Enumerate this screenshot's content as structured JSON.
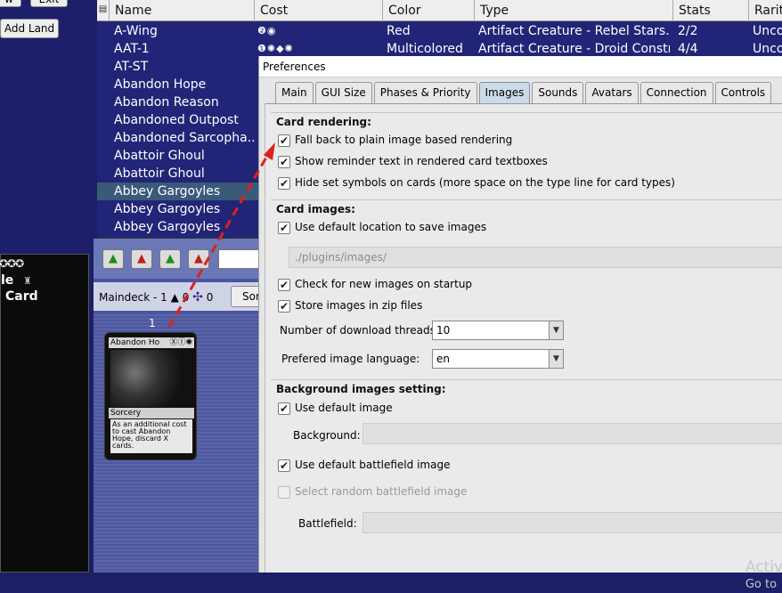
{
  "top_buttons": {
    "first": "w",
    "exit": "Exit",
    "add_land": "Add Land"
  },
  "sidebar_card": {
    "mana": "✪✪✪",
    "line1": "le",
    "line2": "Card"
  },
  "table": {
    "grip": "▤",
    "headers": {
      "name": "Name",
      "cost": "Cost",
      "color": "Color",
      "type": "Type",
      "stats": "Stats",
      "rarity": "Rarity"
    },
    "rows": [
      {
        "name": "A-Wing",
        "cost": "❷◉",
        "color": "Red",
        "type": "Artifact Creature  - Rebel Stars...",
        "stats": "2/2",
        "rarity": "Unco"
      },
      {
        "name": "AAT-1",
        "cost": "❶✺◆✺",
        "color": "Multicolored",
        "type": "Artifact Creature  - Droid Constr...",
        "stats": "4/4",
        "rarity": "Unco"
      },
      {
        "name": "AT-ST",
        "cost": "",
        "color": "",
        "type": "",
        "stats": "",
        "rarity": ""
      },
      {
        "name": "Abandon Hope",
        "cost": "",
        "color": "",
        "type": "",
        "stats": "",
        "rarity": ""
      },
      {
        "name": "Abandon Reason",
        "cost": "",
        "color": "",
        "type": "",
        "stats": "",
        "rarity": ""
      },
      {
        "name": "Abandoned Outpost",
        "cost": "",
        "color": "",
        "type": "",
        "stats": "",
        "rarity": ""
      },
      {
        "name": "Abandoned Sarcopha...",
        "cost": "",
        "color": "",
        "type": "",
        "stats": "",
        "rarity": ""
      },
      {
        "name": "Abattoir Ghoul",
        "cost": "",
        "color": "",
        "type": "",
        "stats": "",
        "rarity": ""
      },
      {
        "name": "Abattoir Ghoul",
        "cost": "",
        "color": "",
        "type": "",
        "stats": "",
        "rarity": ""
      },
      {
        "name": "Abbey Gargoyles",
        "cost": "",
        "color": "",
        "type": "",
        "stats": "",
        "rarity": ""
      },
      {
        "name": "Abbey Gargoyles",
        "cost": "",
        "color": "",
        "type": "",
        "stats": "",
        "rarity": ""
      },
      {
        "name": "Abbey Gargoyles",
        "cost": "",
        "color": "",
        "type": "",
        "stats": "",
        "rarity": ""
      }
    ],
    "selected_row": 9
  },
  "deck": {
    "toolbar_icons": [
      "▲",
      "▲",
      "▲",
      "▲"
    ],
    "maindeck_label": "Maindeck - 1",
    "creature_count": "0",
    "paw_count": "0",
    "sort_label": "Sor",
    "column_number": "1",
    "card": {
      "title": "Abandon Ho",
      "cost": "ⓍⒾ✺",
      "type": "Sorcery",
      "text": "As an additional cost to cast Abandon Hope, discard X cards."
    }
  },
  "preferences": {
    "title": "Preferences",
    "tabs": [
      "Main",
      "GUI Size",
      "Phases & Priority",
      "Images",
      "Sounds",
      "Avatars",
      "Connection",
      "Controls"
    ],
    "active_tab": "Images",
    "card_rendering": {
      "header": "Card rendering:",
      "fallback": "Fall back to plain image based rendering",
      "reminder": "Show reminder text in rendered card textboxes",
      "hide_set": "Hide set symbols on cards (more space on the type line for card types)"
    },
    "card_images": {
      "header": "Card images:",
      "default_location": "Use default location to save images",
      "path": "./plugins/images/",
      "check_new": "Check for new images on startup",
      "store_zip": "Store images in zip files",
      "threads_label": "Number of download threads:",
      "threads_value": "10",
      "language_label": "Prefered image language:",
      "language_value": "en"
    },
    "background": {
      "header": "Background images setting:",
      "default_image": "Use default image",
      "background_label": "Background:",
      "default_battlefield": "Use default battlefield image",
      "random_battlefield": "Select random battlefield image",
      "battlefield_label": "Battlefield:"
    },
    "check_mark": "✔",
    "dropdown_arrow": "▼",
    "watermark_line1": "Activ",
    "watermark_line2": "Go to"
  },
  "colors": {
    "arrow": "#e0201a",
    "selected_row": "#3a5a7a",
    "table_bg": "#222577"
  }
}
